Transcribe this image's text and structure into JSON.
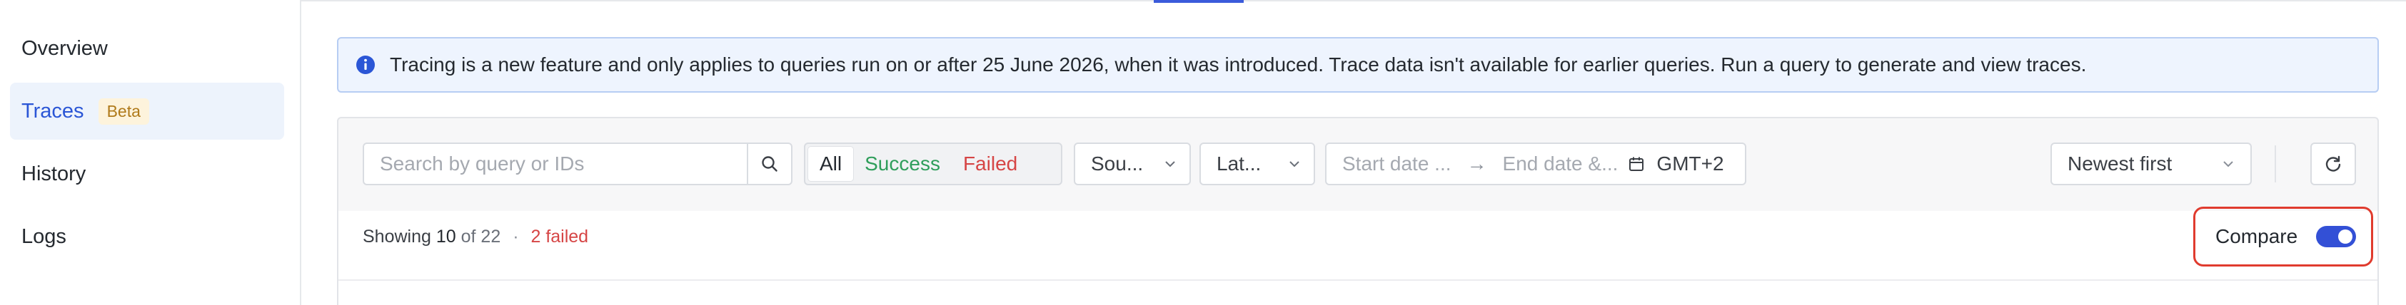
{
  "sidebar": {
    "items": [
      {
        "label": "Overview"
      },
      {
        "label": "Traces",
        "badge": "Beta",
        "active": true
      },
      {
        "label": "History"
      },
      {
        "label": "Logs"
      }
    ]
  },
  "banner": {
    "icon": "info-icon",
    "text": "Tracing is a new feature and only applies to queries run on or after 25 June 2026, when it was introduced. Trace data isn't available for earlier queries. Run a query to generate and view traces."
  },
  "filters": {
    "search_placeholder": "Search by query or IDs",
    "status_tabs": [
      {
        "label": "All",
        "selected": true
      },
      {
        "label": "Success"
      },
      {
        "label": "Failed"
      }
    ],
    "source_label": "Sou...",
    "latency_label": "Lat...",
    "start_date_placeholder": "Start date ...",
    "date_arrow": "→",
    "end_date_placeholder": "End date &...",
    "timezone": "GMT+2",
    "sort_label": "Newest first"
  },
  "summary": {
    "prefix": "Showing",
    "count": "10",
    "of_text": "of 22",
    "separator": "·",
    "failed_text": "2 failed"
  },
  "compare": {
    "label": "Compare",
    "enabled": true
  },
  "colors": {
    "accent": "#3b5bdb",
    "success": "#2f9e5b",
    "failed": "#d64545",
    "beta_bg": "#fdf3dc",
    "beta_text": "#b07a1a",
    "highlight": "#e03b2e"
  }
}
